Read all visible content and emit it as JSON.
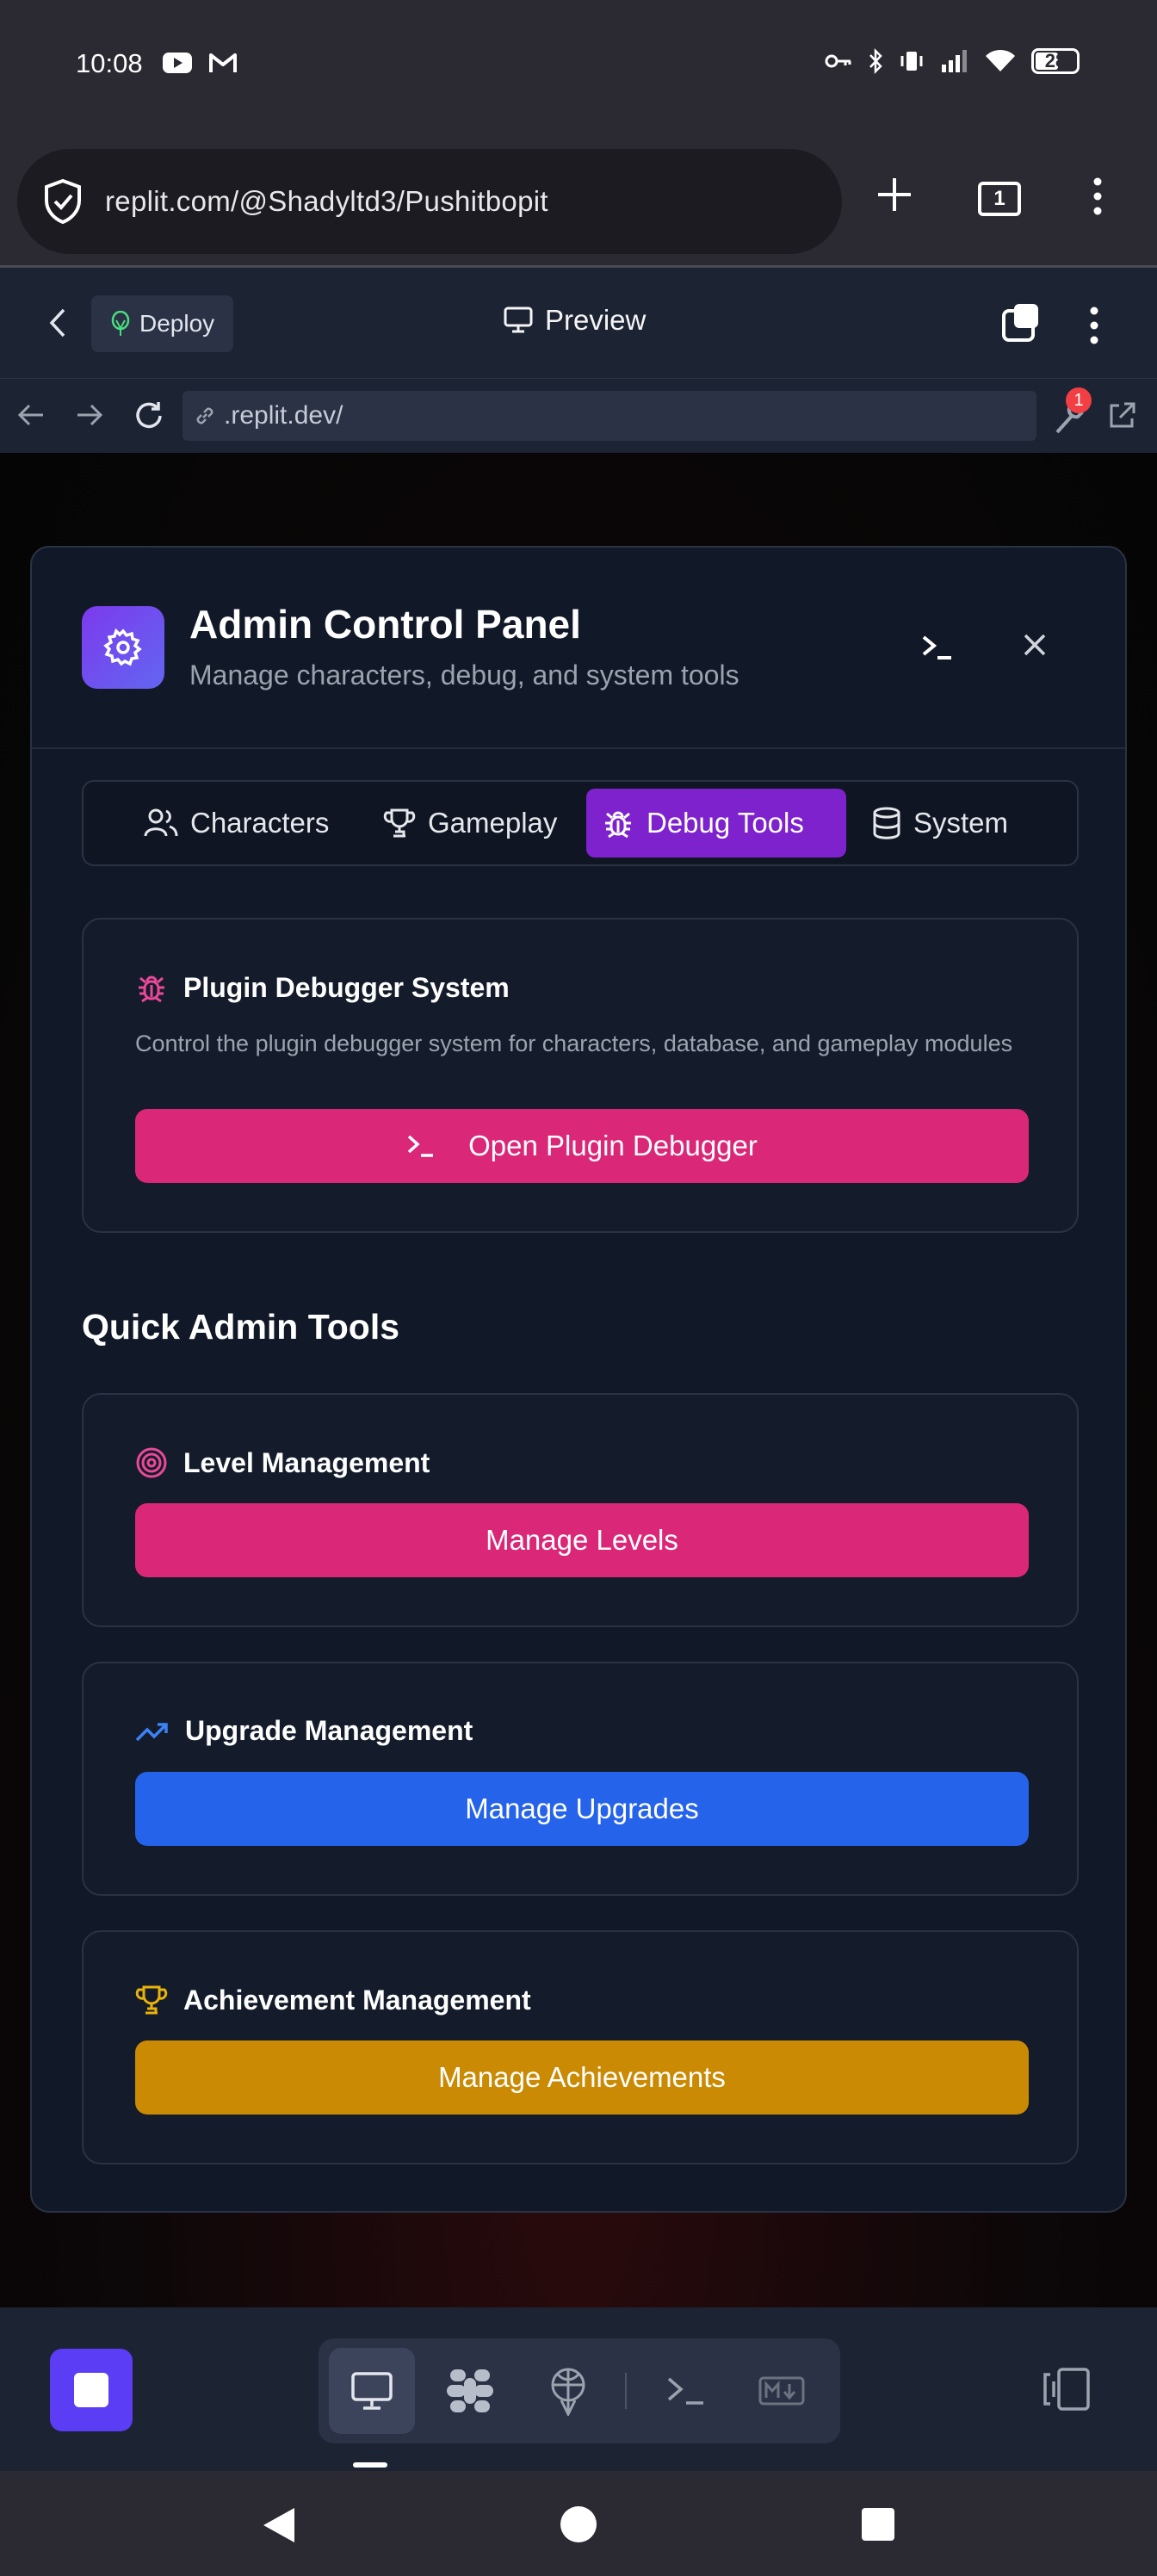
{
  "status_bar": {
    "time": "10:08",
    "battery": "28"
  },
  "browser": {
    "url": "replit.com/@Shadyltd3/Pushitbopit",
    "tab_count": "1"
  },
  "replit_header": {
    "deploy_label": "Deploy",
    "preview_label": "Preview"
  },
  "webview": {
    "address": ".replit.dev/",
    "notification_count": "1"
  },
  "modal": {
    "title": "Admin Control Panel",
    "subtitle": "Manage characters, debug, and system tools",
    "tabs": [
      {
        "label": "Characters",
        "icon": "users-icon",
        "active": false
      },
      {
        "label": "Gameplay",
        "icon": "trophy-icon",
        "active": false
      },
      {
        "label": "Debug Tools",
        "icon": "bug-icon",
        "active": true
      },
      {
        "label": "System",
        "icon": "database-icon",
        "active": false
      }
    ],
    "debugger_card": {
      "title": "Plugin Debugger System",
      "description": "Control the plugin debugger system for characters, database, and gameplay modules",
      "button": "Open Plugin Debugger"
    },
    "quick_tools_title": "Quick Admin Tools",
    "tools": [
      {
        "title": "Level Management",
        "button": "Manage Levels",
        "icon": "target-icon",
        "color": "#db2777"
      },
      {
        "title": "Upgrade Management",
        "button": "Manage Upgrades",
        "icon": "trending-up-icon",
        "color": "#2563eb"
      },
      {
        "title": "Achievement Management",
        "button": "Manage Achievements",
        "icon": "trophy-icon",
        "color": "#ca8a04"
      }
    ]
  },
  "colors": {
    "accent_purple": "#7e22ce",
    "pink": "#db2777",
    "blue": "#2563eb",
    "gold": "#ca8a04"
  }
}
